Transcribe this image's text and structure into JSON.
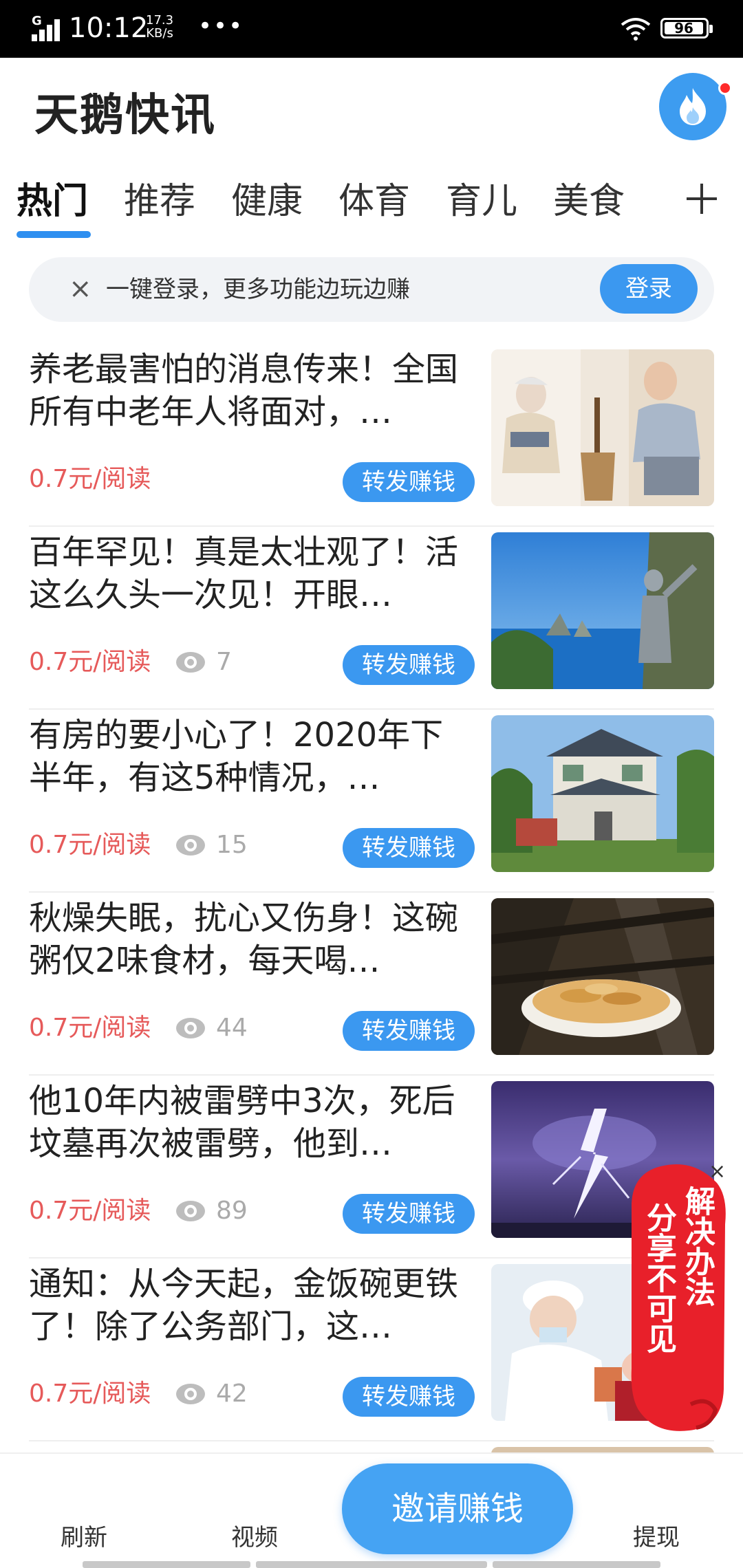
{
  "status_bar": {
    "network": "G",
    "time": "10:12",
    "speed_value": "17.3",
    "speed_unit": "KB/s",
    "more": "•••",
    "battery": "96"
  },
  "header": {
    "title": "天鹅快讯"
  },
  "tabs": [
    {
      "label": "热门",
      "active": true
    },
    {
      "label": "推荐",
      "active": false
    },
    {
      "label": "健康",
      "active": false
    },
    {
      "label": "体育",
      "active": false
    },
    {
      "label": "育儿",
      "active": false
    },
    {
      "label": "美食",
      "active": false
    }
  ],
  "login_banner": {
    "close": "×",
    "text": "一键登录，更多功能边玩边赚",
    "button": "登录"
  },
  "news": [
    {
      "title": "养老最害怕的消息传来！全国所有中老年人将面对，…",
      "price": "0.7元/阅读",
      "views": null,
      "share": "转发赚钱",
      "thumb": "elderly-couple"
    },
    {
      "title": "百年罕见！真是太壮观了！活这么久头一次见！开眼…",
      "price": "0.7元/阅读",
      "views": "7",
      "share": "转发赚钱",
      "thumb": "coast-statue"
    },
    {
      "title": "有房的要小心了！2020年下半年，有这5种情况，…",
      "price": "0.7元/阅读",
      "views": "15",
      "share": "转发赚钱",
      "thumb": "house"
    },
    {
      "title": "秋燥失眠，扰心又伤身！这碗粥仅2味食材，每天喝…",
      "price": "0.7元/阅读",
      "views": "44",
      "share": "转发赚钱",
      "thumb": "bowl"
    },
    {
      "title": "他10年内被雷劈中3次，死后坟墓再次被雷劈，他到…",
      "price": "0.7元/阅读",
      "views": "89",
      "share": "转发赚钱",
      "thumb": "lightning"
    },
    {
      "title": "通知：从今天起，金饭碗更铁了！除了公务部门，这…",
      "price": "0.7元/阅读",
      "views": "42",
      "share": "转发赚钱",
      "thumb": "nurse"
    }
  ],
  "float_badge": {
    "close": "×",
    "line1": "解决办法",
    "line2": "分享不可见"
  },
  "bottom_bar": {
    "refresh": "刷新",
    "video": "视频",
    "invite": "邀请赚钱",
    "withdraw": "提现"
  },
  "colors": {
    "accent": "#3b98f0",
    "price": "#e65a5a",
    "badge": "#e8202a"
  }
}
